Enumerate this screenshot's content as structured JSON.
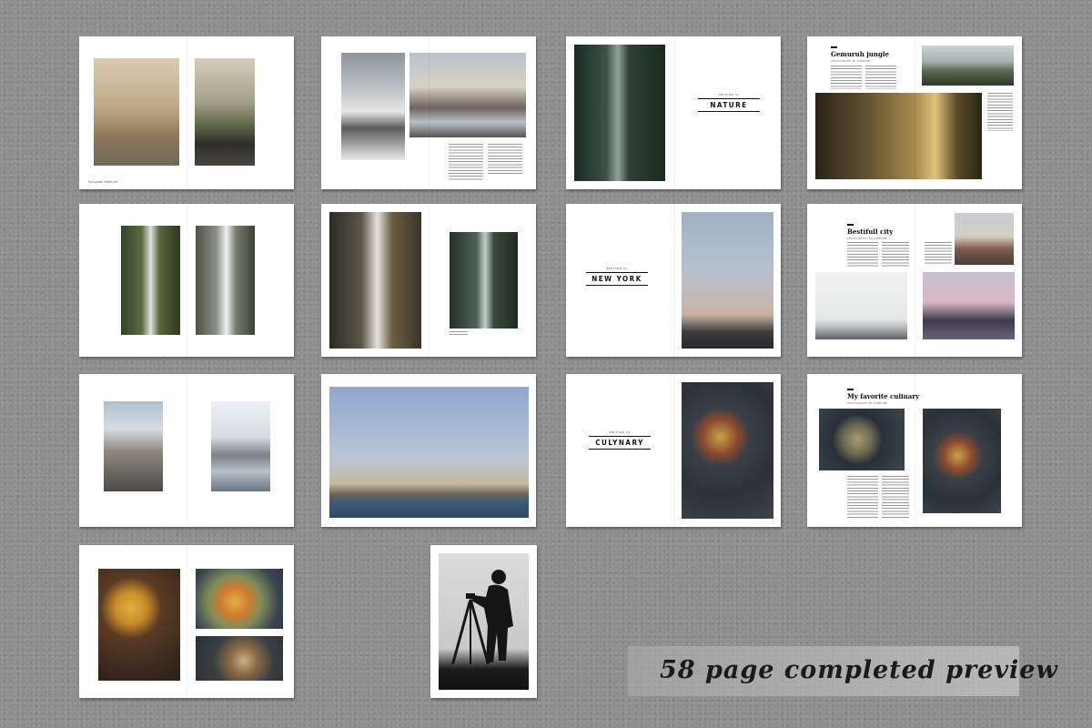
{
  "caption": "58 page completed preview",
  "spreads": {
    "nature": {
      "section_small": "SECTION 02",
      "section_title": "NATURE"
    },
    "gemuruh": {
      "title": "Gemuruh jungle",
      "subtitle": "PHOTOGRAPHY BY SOMEONE"
    },
    "newyork": {
      "section_small": "SECTION 03",
      "section_title": "NEW YORK"
    },
    "city": {
      "title": "Bestifull city",
      "subtitle": "PHOTOGRAPHY BY SOMEONE"
    },
    "culynary": {
      "section_small": "SECTION 04",
      "section_title": "CULYNARY"
    },
    "culinary": {
      "title": "My favorite culinary",
      "subtitle": "PHOTOGRAPHY BY SOMEONE"
    }
  },
  "folio_label": "MAGAZINE TEMPLATE",
  "colors": {
    "background": "#8f8f8f",
    "page": "#ffffff",
    "caption_text": "#1a1a1a"
  }
}
